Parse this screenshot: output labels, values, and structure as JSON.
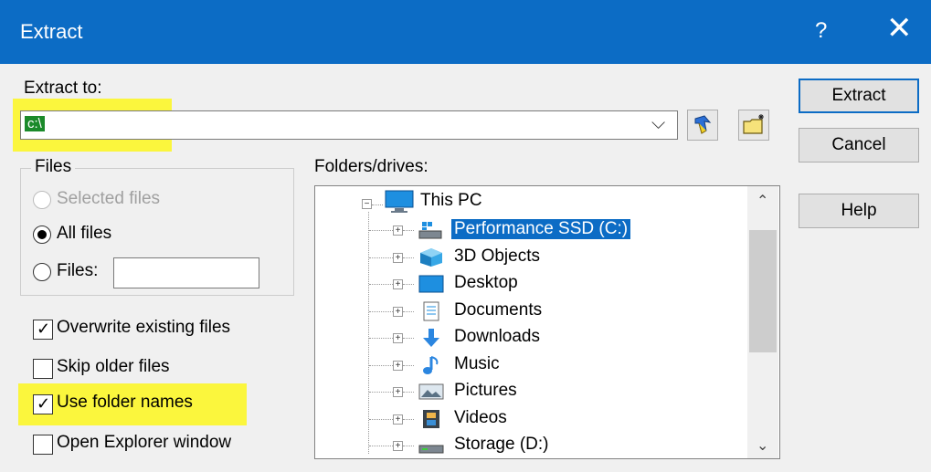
{
  "window": {
    "title": "Extract",
    "help_glyph": "?",
    "close_glyph": "✕"
  },
  "extract_to": {
    "label": "Extract to:",
    "value": "c:\\",
    "dropdown_glyph": "⌵"
  },
  "buttons": {
    "extract": "Extract",
    "cancel": "Cancel",
    "help": "Help"
  },
  "files_group": {
    "caption": "Files",
    "options": [
      {
        "label": "Selected files",
        "checked": false,
        "disabled": true
      },
      {
        "label": "All files",
        "checked": true,
        "disabled": false
      },
      {
        "label": "Files:",
        "checked": false,
        "disabled": false
      }
    ],
    "files_input_value": ""
  },
  "checkboxes": [
    {
      "label": "Overwrite existing files",
      "checked": true
    },
    {
      "label": "Skip older files",
      "checked": false
    },
    {
      "label": "Use folder names",
      "checked": true,
      "highlighted": true
    },
    {
      "label": "Open Explorer window",
      "checked": false
    }
  ],
  "folders": {
    "label": "Folders/drives:",
    "root": {
      "label": "This PC",
      "icon": "monitor-icon",
      "expanded": true
    },
    "items": [
      {
        "label": "Performance SSD (C:)",
        "icon": "system-drive-icon",
        "selected": true
      },
      {
        "label": "3D Objects",
        "icon": "3d-objects-icon"
      },
      {
        "label": "Desktop",
        "icon": "desktop-icon"
      },
      {
        "label": "Documents",
        "icon": "documents-icon"
      },
      {
        "label": "Downloads",
        "icon": "downloads-icon"
      },
      {
        "label": "Music",
        "icon": "music-icon"
      },
      {
        "label": "Pictures",
        "icon": "pictures-icon"
      },
      {
        "label": "Videos",
        "icon": "videos-icon"
      },
      {
        "label": "Storage (D:)",
        "icon": "drive-icon"
      }
    ]
  },
  "colors": {
    "title_bar": "#0c6cc5",
    "highlight": "#fbf63d",
    "selection": "#0c6cc5"
  }
}
